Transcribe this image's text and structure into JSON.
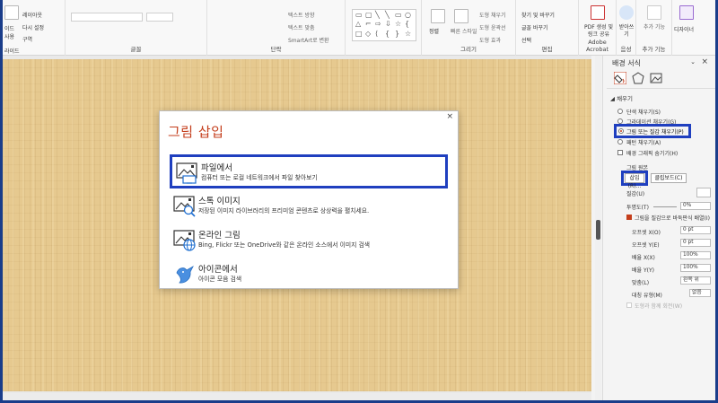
{
  "colors": {
    "accent": "#c43e1c",
    "highlight": "#1f3fbf",
    "wood": "#e6c98f"
  },
  "ribbon": {
    "left_small": [
      "레이아웃",
      "다시 설정",
      "구역"
    ],
    "left_labels": [
      "이드",
      "사용",
      "라이드"
    ],
    "group_labels": {
      "font": "글꼴",
      "paragraph": "단락",
      "drawing": "그리기",
      "editing": "편집",
      "adobe": "Adobe Acrobat",
      "voice": "음성",
      "addins": "추가 기능"
    },
    "paragraph_items": [
      "텍스트 방향",
      "텍스트 맞춤",
      "SmartArt로 변환"
    ],
    "drawing_items": [
      "정렬",
      "빠른 스타일",
      "도형 채우기",
      "도형 윤곽선",
      "도형 효과"
    ],
    "editing_items": [
      "찾기 및 바꾸기",
      "글꼴 바꾸기",
      "선택"
    ],
    "pdf_label": "PDF 생성 및 링크 공유",
    "dictate_label": "받아쓰기",
    "addins_label": "추가 기능",
    "designer_label": "디자이너"
  },
  "dialog": {
    "close": "×",
    "title": "그림 삽입",
    "options": [
      {
        "icon": "picture-from-file-icon",
        "title": "파일에서",
        "desc": "컴퓨터 또는 로컬 네트워크에서 파일 찾아보기"
      },
      {
        "icon": "stock-images-icon",
        "title": "스톡 이미지",
        "desc": "저장된 이미지 라이브러리의 프리미엄 콘텐츠로 상상력을 펼치세요."
      },
      {
        "icon": "online-pictures-icon",
        "title": "온라인 그림",
        "desc": "Bing, Flickr 또는 OneDrive와 같은 온라인 소스에서 이미지 검색"
      },
      {
        "icon": "icons-bird-icon",
        "title": "아이콘에서",
        "desc": "아이콘 모음 검색"
      }
    ]
  },
  "pane": {
    "title": "배경 서식",
    "close": "×",
    "dropdown": "⌄",
    "section": "채우기",
    "fill_options": [
      "단색 채우기(S)",
      "그라데이션 채우기(G)",
      "그림 또는 질감 채우기(P)",
      "패턴 채우기(A)"
    ],
    "hide_graphics": "배경 그래픽 숨기기(H)",
    "picture_source": "그림 원본",
    "insert_button": "삽입(R)...",
    "clipboard_button": "클립보드(C)",
    "texture_label": "질감(U)",
    "transparency_label": "투명도(T)",
    "transparency_value": "0%",
    "tile_check": "그림을 질감으로 바둑판식 배열(I)",
    "offset_x_label": "오프셋 X(O)",
    "offset_x_value": "0 pt",
    "offset_y_label": "오프셋 Y(E)",
    "offset_y_value": "0 pt",
    "scale_x_label": "배율 X(X)",
    "scale_x_value": "100%",
    "scale_y_label": "배율 Y(Y)",
    "scale_y_value": "100%",
    "alignment_label": "맞춤(L)",
    "alignment_value": "왼쪽 위",
    "mirror_label": "대칭 유형(M)",
    "mirror_value": "없음",
    "rotate_with_shape": "도형과 함께 회전(W)"
  }
}
